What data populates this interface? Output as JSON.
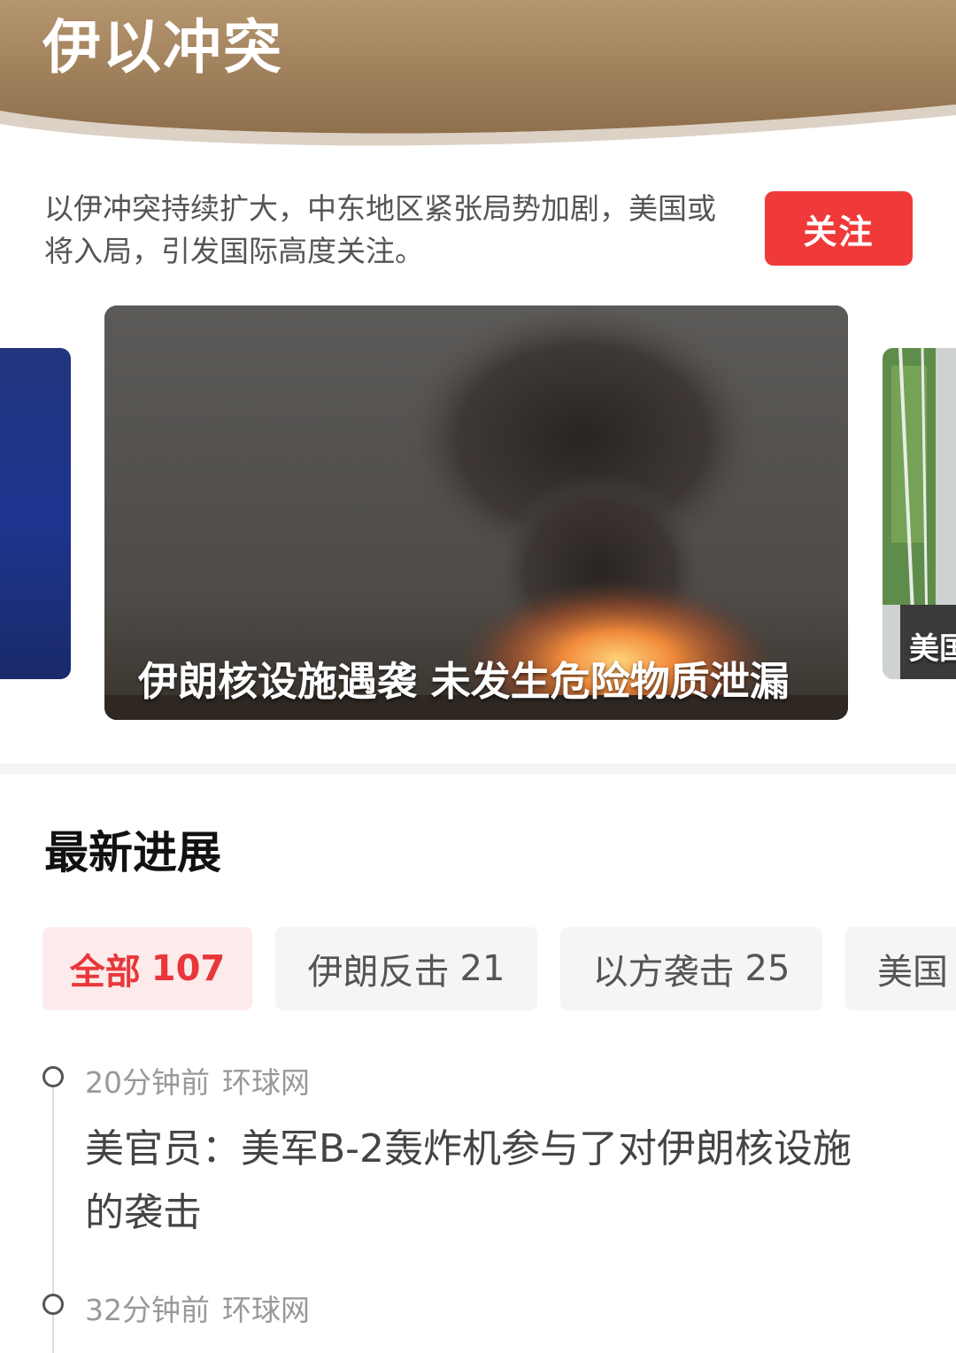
{
  "header": {
    "title": "伊以冲突"
  },
  "topic": {
    "description": "以伊冲突持续扩大，中东地区紧张局势加剧，美国或将入局，引发国际高度关注。",
    "follow_label": "关注"
  },
  "carousel": {
    "main_caption": "伊朗核设施遇袭 未发生危险物质泄漏",
    "right_caption": "美国"
  },
  "latest": {
    "section_title": "最新进展",
    "tabs": [
      {
        "label": "全部",
        "count": "107",
        "active": true
      },
      {
        "label": "伊朗反击",
        "count": "21",
        "active": false
      },
      {
        "label": "以方袭击",
        "count": "25",
        "active": false
      },
      {
        "label": "美国",
        "count": "",
        "active": false
      }
    ],
    "items": [
      {
        "time": "20分钟前",
        "source": "环球网",
        "title": "美官员：美军B-2轰炸机参与了对伊朗核设施的袭击"
      },
      {
        "time": "32分钟前",
        "source": "环球网",
        "title": ""
      }
    ]
  },
  "colors": {
    "header_brown": "#9a7a57",
    "accent_red": "#f03a3a",
    "active_tab_bg": "#fdeaea"
  }
}
